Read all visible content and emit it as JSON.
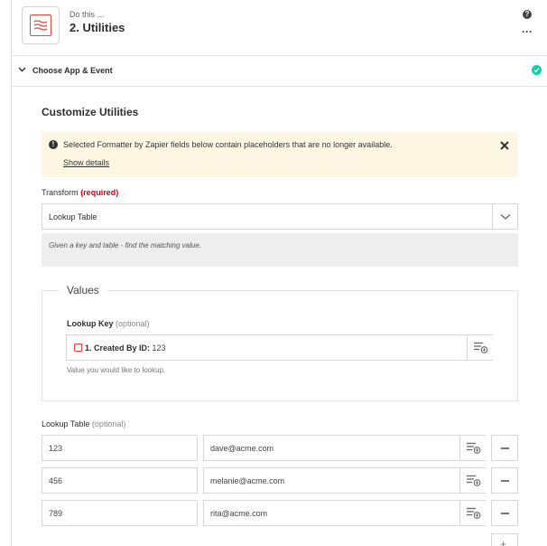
{
  "step": {
    "kicker": "Do this ...",
    "title": "2. Utilities",
    "help_glyph": "?",
    "more_glyph": "···"
  },
  "section": {
    "label": "Choose App & Event"
  },
  "form": {
    "title": "Customize Utilities",
    "alert": {
      "icon_glyph": "!",
      "message": "Selected Formatter by Zapier fields below contain placeholders that are no longer available.",
      "link": "Show details"
    },
    "transform": {
      "label": "Transform",
      "required": "(required)",
      "value": "Lookup Table",
      "help": "Given a key and table - find the matching value."
    },
    "values": {
      "legend": "Values",
      "lookup_key": {
        "label": "Lookup Key",
        "optional": "(optional)",
        "pill_label": "1. Created By ID:",
        "pill_value": "123",
        "hint": "Value you would like to lookup."
      }
    },
    "lookup_table": {
      "label": "Lookup Table",
      "optional": "(optional)",
      "rows": [
        {
          "key": "123",
          "value": "dave@acme.com"
        },
        {
          "key": "456",
          "value": "melanie@acme.com"
        },
        {
          "key": "789",
          "value": "rita@acme.com"
        }
      ],
      "add_glyph": "+"
    }
  },
  "colors": {
    "brand_red": "#e5483f",
    "success": "#13d0ab",
    "alert_bg": "#fdf7e4",
    "required": "#d0021b"
  },
  "icons": [
    "formatter-icon",
    "help-icon",
    "more-icon",
    "chevron-down-icon",
    "check-circle-icon",
    "alert-icon",
    "close-icon",
    "insert-data-icon",
    "remove-icon",
    "add-icon"
  ]
}
